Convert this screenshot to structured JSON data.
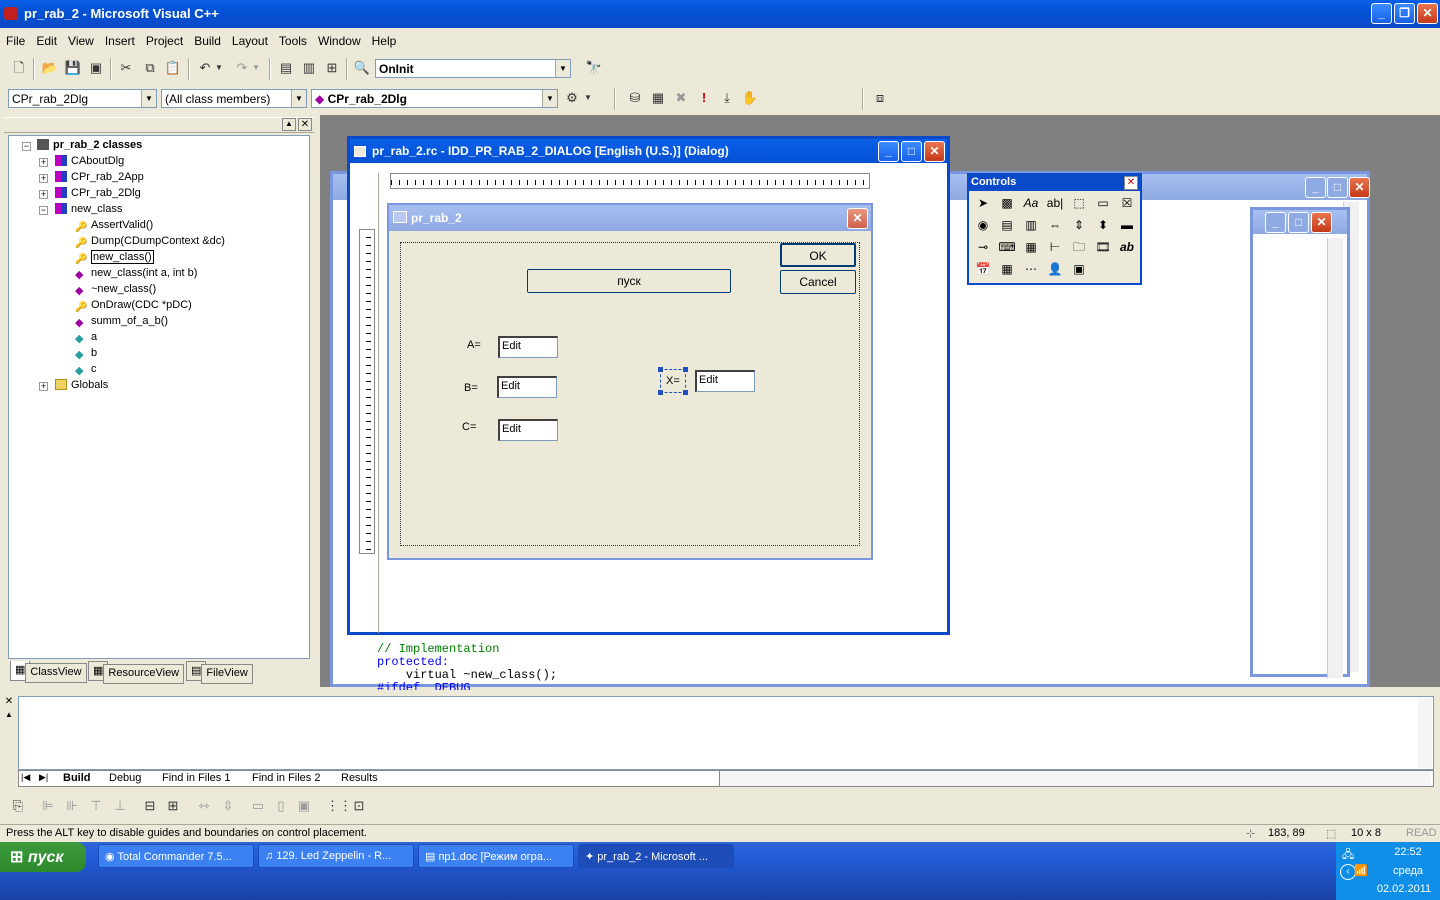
{
  "title": "pr_rab_2 - Microsoft Visual C++",
  "menu": [
    "File",
    "Edit",
    "View",
    "Insert",
    "Project",
    "Build",
    "Layout",
    "Tools",
    "Window",
    "Help"
  ],
  "toolbar": {
    "function_combo": "OnInit"
  },
  "wizardbar": {
    "class_combo": "CPr_rab_2Dlg",
    "filter_combo": "(All class members)",
    "member_combo": "CPr_rab_2Dlg"
  },
  "tree": {
    "root": "pr_rab_2 classes",
    "items": [
      {
        "label": "CAboutDlg"
      },
      {
        "label": "CPr_rab_2App"
      },
      {
        "label": "CPr_rab_2Dlg"
      },
      {
        "label": "new_class"
      },
      {
        "label": "AssertValid()"
      },
      {
        "label": "Dump(CDumpContext &dc)"
      },
      {
        "label": "new_class()"
      },
      {
        "label": "new_class(int a, int b)"
      },
      {
        "label": "~new_class()"
      },
      {
        "label": "OnDraw(CDC *pDC)"
      },
      {
        "label": "summ_of_a_b()"
      },
      {
        "label": "a"
      },
      {
        "label": "b"
      },
      {
        "label": "c"
      },
      {
        "label": "Globals"
      }
    ]
  },
  "workspace_tabs": [
    "ClassView",
    "ResourceView",
    "FileView"
  ],
  "rc_window": {
    "title": "pr_rab_2.rc - IDD_PR_RAB_2_DIALOG [English (U.S.)] (Dialog)"
  },
  "dialog": {
    "title": "pr_rab_2",
    "ok": "OK",
    "cancel": "Cancel",
    "start_button": "пуск",
    "label_a": "A=",
    "label_b": "B=",
    "label_c": "C=",
    "label_x": "X=",
    "edit_a": "Edit",
    "edit_b": "Edit",
    "edit_c": "Edit",
    "edit_x": "Edit"
  },
  "controls_palette": {
    "title": "Controls"
  },
  "code_lines": [
    "// Implementation",
    "protected:",
    "    virtual ~new_class();",
    "#ifdef _DEBUG"
  ],
  "output_tabs": [
    "Build",
    "Debug",
    "Find in Files 1",
    "Find in Files 2",
    "Results"
  ],
  "status": {
    "message": "Press the ALT key to disable guides and boundaries on control placement.",
    "position": "183, 89",
    "size": "10 x 8",
    "mode": "READ"
  },
  "taskbar": {
    "start": "пуск",
    "tasks": [
      "Total Commander 7.5...",
      "129. Led Zeppelin - R...",
      "пр1.doc [Режим огра...",
      "pr_rab_2 - Microsoft ..."
    ],
    "time": "22:52",
    "day": "среда",
    "date": "02.02.2011"
  },
  "colors": {
    "titlebar": "#0a4ac8",
    "code_keyword": "#0000ff",
    "code_comment": "#008000"
  }
}
